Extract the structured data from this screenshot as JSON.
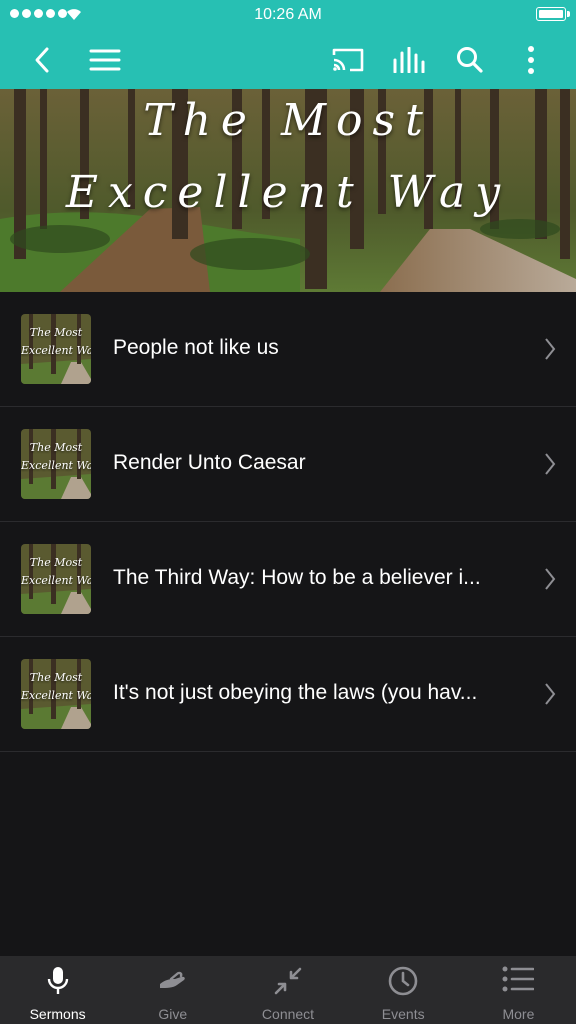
{
  "status_bar": {
    "time": "10:26 AM"
  },
  "nav": {
    "back": "back-icon",
    "menu": "hamburger-menu-icon",
    "cast": "cast-icon",
    "audio": "audio-bars-icon",
    "search": "search-icon",
    "more": "more-vertical-icon"
  },
  "hero": {
    "title_line1": "The Most",
    "title_line2": "Excellent Way"
  },
  "sermons": [
    {
      "title": "People not like us",
      "thumb_line1": "The Most",
      "thumb_line2": "Excellent Way"
    },
    {
      "title": "Render Unto Caesar",
      "thumb_line1": "The Most",
      "thumb_line2": "Excellent Way"
    },
    {
      "title": "The Third Way: How to be a believer i...",
      "thumb_line1": "The Most",
      "thumb_line2": "Excellent Way"
    },
    {
      "title": "It's not just obeying the laws (you hav...",
      "thumb_line1": "The Most",
      "thumb_line2": "Excellent Way"
    }
  ],
  "tabs": [
    {
      "label": "Sermons",
      "icon": "microphone-icon",
      "active": true
    },
    {
      "label": "Give",
      "icon": "hand-icon",
      "active": false
    },
    {
      "label": "Connect",
      "icon": "connect-arrows-icon",
      "active": false
    },
    {
      "label": "Events",
      "icon": "clock-icon",
      "active": false
    },
    {
      "label": "More",
      "icon": "list-icon",
      "active": false
    }
  ],
  "colors": {
    "accent": "#27c0b3",
    "background": "#151517",
    "tabbar": "#2a2a2c",
    "inactive": "#8e8e93"
  }
}
